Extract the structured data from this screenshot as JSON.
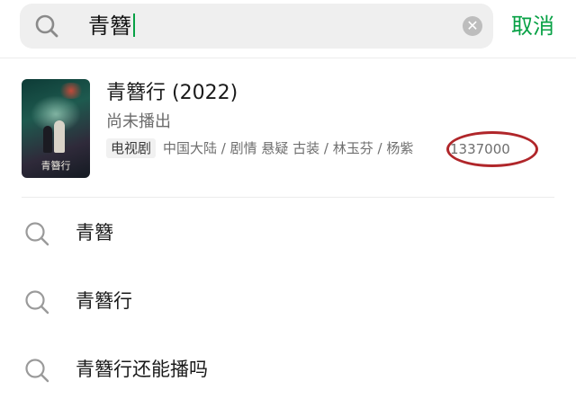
{
  "search": {
    "query": "青簪",
    "clear_icon": "clear-icon",
    "cancel_label": "取消"
  },
  "result": {
    "title": "青簪行 (2022)",
    "status": "尚未播出",
    "type_tag": "电视剧",
    "meta": "中国大陆 / 剧情 悬疑 古装 / 林玉芬 / 杨紫",
    "count": "1337000",
    "poster_title": "青簪行"
  },
  "suggestions": [
    {
      "label": "青簪"
    },
    {
      "label": "青簪行"
    },
    {
      "label": "青簪行还能播吗"
    }
  ],
  "colors": {
    "accent": "#07a145",
    "annotation_ring": "#b0262a"
  }
}
